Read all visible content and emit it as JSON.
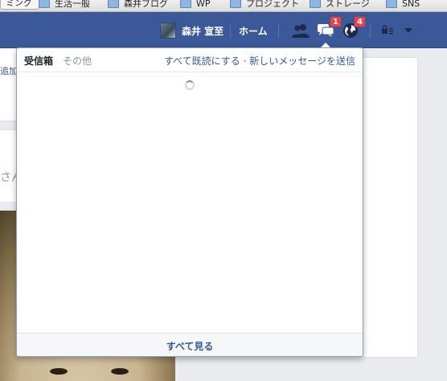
{
  "bookmarks": {
    "first_button": "ミング",
    "items": [
      "生活一般",
      "森井ブログ",
      "WP",
      "プロジェクト",
      "ストレージ",
      "SNS"
    ]
  },
  "topbar": {
    "user_name": "森井 宣至",
    "home_label": "ホーム",
    "message_badge": "1",
    "notification_badge": "4",
    "colors": {
      "bar": "#3b5998",
      "badge": "#fa3e3e"
    }
  },
  "page": {
    "left_snippet_1": "追加",
    "left_snippet_2": "さん"
  },
  "flyout": {
    "tab_inbox": "受信箱",
    "tab_other": "その他",
    "mark_all_read": "すべて既読にする",
    "link_separator": "·",
    "new_message": "新しいメッセージを送信",
    "see_all": "すべて見る",
    "loading_icon": "spinner-icon"
  }
}
